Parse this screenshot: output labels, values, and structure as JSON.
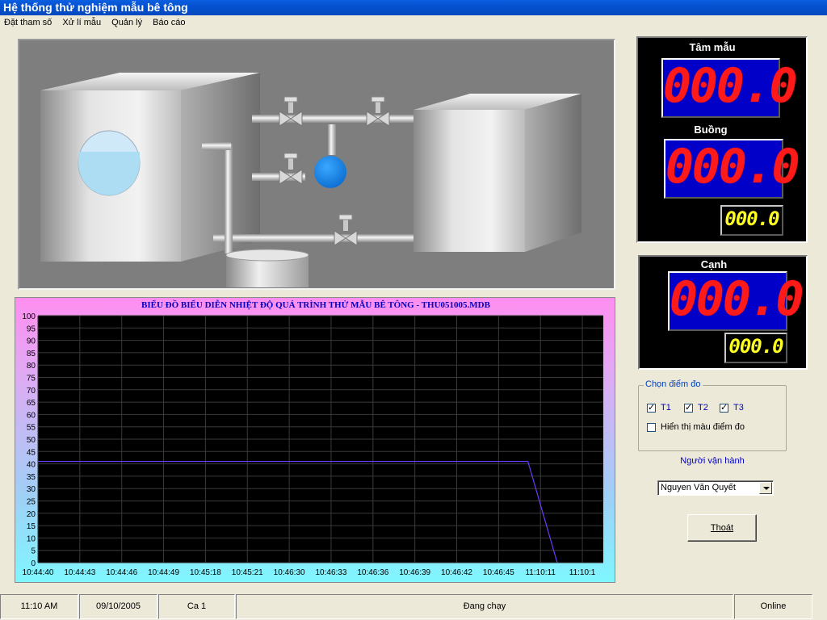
{
  "window": {
    "title": "Hệ thống thử nghiệm mẫu bê tông"
  },
  "menu": [
    "Đặt tham số",
    "Xử lí mẫu",
    "Quản lý",
    "Báo cáo"
  ],
  "chart_data": {
    "type": "line",
    "title": "BIỂU ĐỒ BIỂU DIỄN NHIỆT ĐỘ QUÁ TRÌNH THỬ MẪU BÊ TÔNG - THU051005.MDB",
    "xlabel": "",
    "ylabel": "",
    "ylim": [
      0,
      100
    ],
    "y_ticks": [
      100,
      95,
      90,
      85,
      80,
      75,
      70,
      65,
      60,
      55,
      50,
      45,
      40,
      35,
      30,
      25,
      20,
      15,
      10,
      5,
      0
    ],
    "x_ticks": [
      "10:44:40",
      "10:44:43",
      "10:44:46",
      "10:44:49",
      "10:45:18",
      "10:45:21",
      "10:46:30",
      "10:46:33",
      "10:46:36",
      "10:46:39",
      "10:46:42",
      "10:46:45",
      "11:10:11",
      "11:10:1"
    ],
    "grid": true,
    "series": [
      {
        "color": "#6a3cff",
        "x": [
          0,
          11.7,
          12.4
        ],
        "y": [
          41,
          41,
          0
        ]
      }
    ]
  },
  "panels": {
    "sample_core": {
      "label": "Tâm mẫu",
      "value": "000.0"
    },
    "chamber": {
      "label": "Buồng",
      "value": "000.0",
      "small_value": "000.0"
    },
    "edge": {
      "label": "Cạnh",
      "value": "000.0",
      "small_value": "000.0"
    }
  },
  "measure_points": {
    "legend": "Chọn điểm đo",
    "t1": "T1",
    "t2": "T2",
    "t3": "T3",
    "show_color": "Hiển thị màu điểm  đo"
  },
  "operator": {
    "label": "Người vận hành",
    "selected": "Nguyen Văn  Quyết"
  },
  "exit_button": "Thoát",
  "status": {
    "time": "11:10 AM",
    "date": "09/10/2005",
    "shift": "Ca 1",
    "state": "Đang chạy",
    "connection": "Online"
  },
  "colors": {
    "title_bar": "#0550d0",
    "chart_bg": "#000000",
    "lcd_red": "#ff1a1a",
    "lcd_yellow": "#ffff20",
    "lcd_blue": "#0000c8"
  }
}
